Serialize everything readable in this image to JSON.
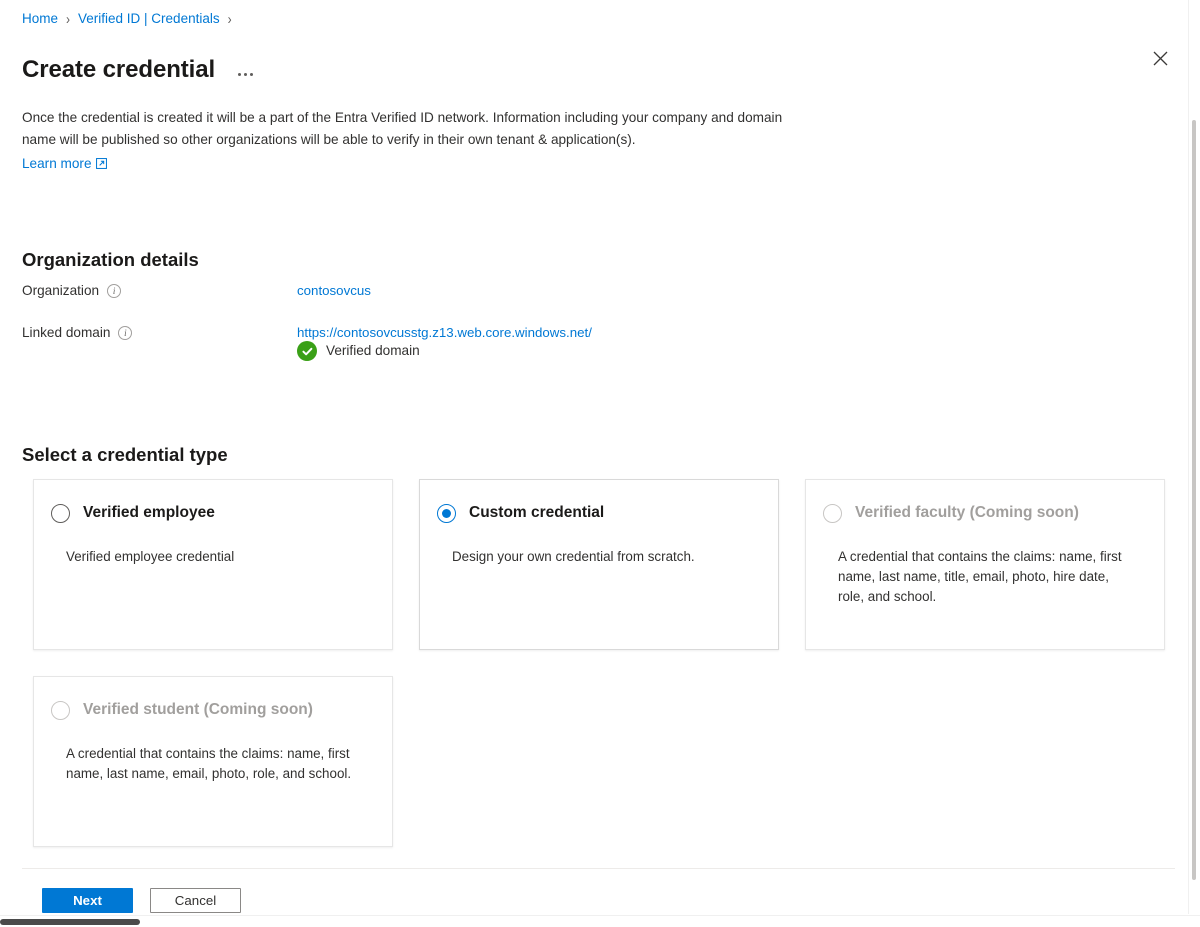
{
  "breadcrumb": {
    "items": [
      {
        "label": "Home"
      },
      {
        "label": "Verified ID | Credentials"
      }
    ],
    "separator": "›"
  },
  "header": {
    "title": "Create credential",
    "more_menu": "…",
    "close_label": "Close"
  },
  "intro": {
    "text": "Once the credential is created it will be a part of the Entra Verified ID network. Information including your company and domain name will be published so other organizations will be able to verify in their own tenant & application(s).",
    "learn_more_label": "Learn more"
  },
  "organization_details": {
    "heading": "Organization details",
    "fields": [
      {
        "label": "Organization",
        "value": "contosovcus",
        "info_glyph": "i"
      },
      {
        "label": "Linked domain",
        "value": "https://contosovcusstg.z13.web.core.windows.net/",
        "info_glyph": "i",
        "status_text": "Verified domain",
        "status_color": "#3aa017"
      }
    ]
  },
  "credential_type": {
    "heading": "Select a credential type",
    "options": [
      {
        "title": "Verified employee",
        "description": "Verified employee credential",
        "selected": false,
        "disabled": false
      },
      {
        "title": "Custom credential",
        "description": "Design your own credential from scratch.",
        "selected": true,
        "disabled": false
      },
      {
        "title": "Verified faculty (Coming soon)",
        "description": "A credential that contains the claims: name, first name, last name, title, email, photo, hire date, role, and school.",
        "selected": false,
        "disabled": true
      },
      {
        "title": "Verified student (Coming soon)",
        "description": "A credential that contains the claims: name, first name, last name, email, photo, role, and school.",
        "selected": false,
        "disabled": true
      }
    ]
  },
  "footer": {
    "next_label": "Next",
    "cancel_label": "Cancel"
  },
  "colors": {
    "accent": "#0078d4",
    "link": "#0078d4",
    "success": "#3aa017",
    "text": "#323130",
    "disabled_text": "#a19f9d"
  }
}
